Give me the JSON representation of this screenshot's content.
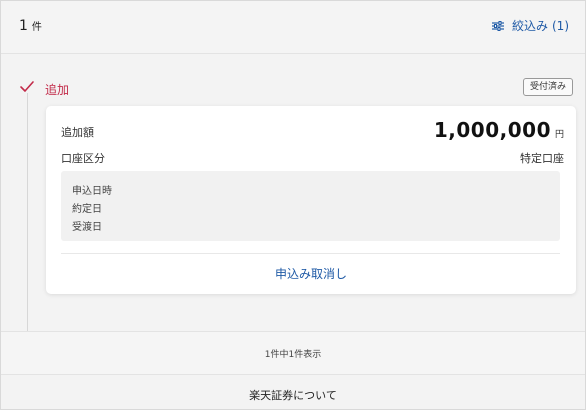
{
  "header": {
    "count_number": "1",
    "count_unit": "件",
    "filter_label": "絞込み",
    "filter_count": "(1)"
  },
  "entry": {
    "status": "追加",
    "badge": "受付済み",
    "amount_label": "追加額",
    "amount_value": "1,000,000",
    "amount_unit": "円",
    "account_label": "口座区分",
    "account_value": "特定口座",
    "dates": [
      "申込日時",
      "約定日",
      "受渡日"
    ],
    "cancel_label": "申込み取消し"
  },
  "footer": {
    "result_text": "1件中1件表示",
    "about_label": "楽天証券について"
  },
  "colors": {
    "accent_link": "#1f5aa6",
    "status_red": "#c22a49"
  },
  "icons": {
    "filter": "sliders-icon",
    "status": "check-icon"
  }
}
